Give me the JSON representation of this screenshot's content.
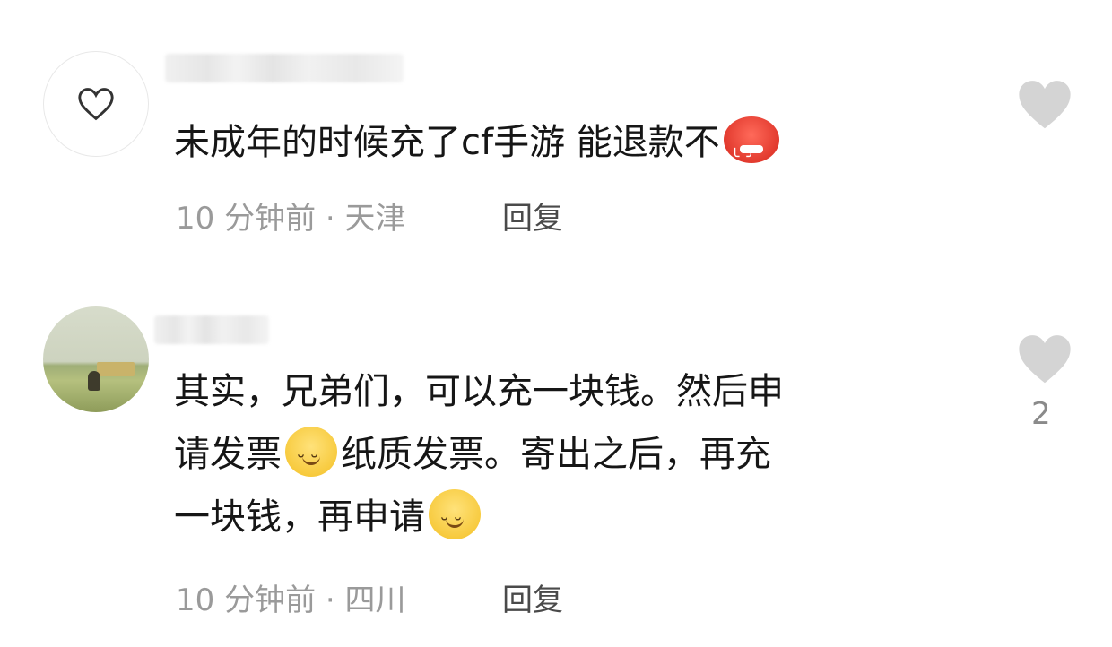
{
  "comments": [
    {
      "text_before_emoji": "未成年的时候充了cf手游 能退款不",
      "emoji": "angry-face",
      "time": "10 分钟前",
      "location": "天津",
      "reply_label": "回复",
      "likes": ""
    },
    {
      "line1": "其实，兄弟们，可以充一块钱。然后申",
      "line2a": "请发票",
      "line2b": "纸质发票。寄出之后，再充",
      "line3": "一块钱，再申请",
      "emoji": "smiling-face",
      "time": "10 分钟前",
      "location": "四川",
      "reply_label": "回复",
      "likes": "2"
    }
  ],
  "colors": {
    "heart": "#d4d4d4",
    "meta": "#9a9a9a",
    "text": "#161616"
  },
  "separator": "·"
}
